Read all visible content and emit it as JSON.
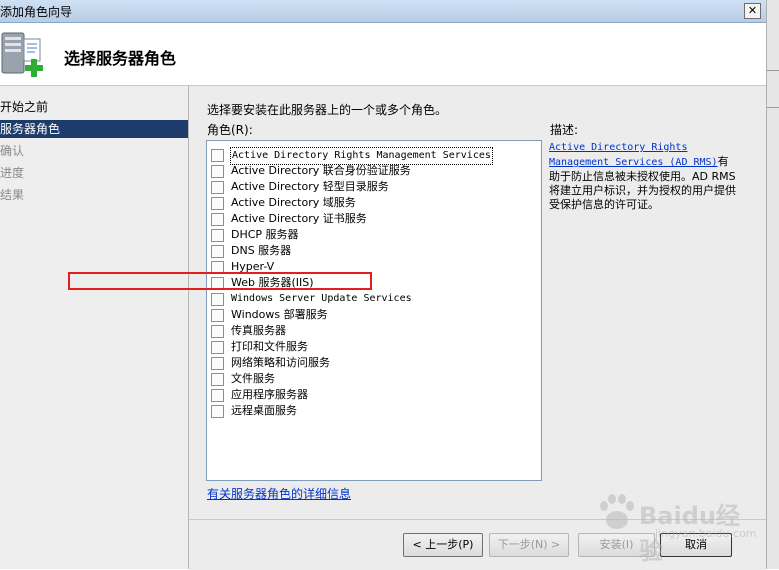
{
  "window": {
    "title": "添加角色向导",
    "close_glyph": "✕"
  },
  "header": {
    "title": "选择服务器角色",
    "icon": "server-add-icon"
  },
  "nav": {
    "items": [
      {
        "label": "开始之前",
        "state": "normal"
      },
      {
        "label": "服务器角色",
        "state": "active"
      },
      {
        "label": "确认",
        "state": "dim"
      },
      {
        "label": "进度",
        "state": "dim"
      },
      {
        "label": "结果",
        "state": "dim"
      }
    ]
  },
  "main": {
    "instruction": "选择要安装在此服务器上的一个或多个角色。",
    "roles_label": "角色(R):",
    "description_label": "描述:",
    "roles": [
      {
        "label": "Active Directory Rights Management Services",
        "checked": false
      },
      {
        "label": "Active Directory 联合身份验证服务",
        "checked": false
      },
      {
        "label": "Active Directory 轻型目录服务",
        "checked": false
      },
      {
        "label": "Active Directory 域服务",
        "checked": false
      },
      {
        "label": "Active Directory 证书服务",
        "checked": false
      },
      {
        "label": "DHCP 服务器",
        "checked": false
      },
      {
        "label": "DNS 服务器",
        "checked": false
      },
      {
        "label": "Hyper-V",
        "checked": false
      },
      {
        "label": "Web 服务器(IIS)",
        "checked": false
      },
      {
        "label": "Windows Server Update Services",
        "checked": false
      },
      {
        "label": "Windows 部署服务",
        "checked": false
      },
      {
        "label": "传真服务器",
        "checked": false
      },
      {
        "label": "打印和文件服务",
        "checked": false
      },
      {
        "label": "网络策略和访问服务",
        "checked": false
      },
      {
        "label": "文件服务",
        "checked": false
      },
      {
        "label": "应用程序服务器",
        "checked": false
      },
      {
        "label": "远程桌面服务",
        "checked": false
      }
    ],
    "description": {
      "link_text": "Active Directory Rights Management Services (AD RMS)",
      "text": "有助于防止信息被未授权使用。AD RMS 将建立用户标识，并为授权的用户提供受保护信息的许可证。"
    },
    "more_info_link": "有关服务器角色的详细信息"
  },
  "footer": {
    "back": "< 上一步(P)",
    "next": "下一步(N) >",
    "install": "安装(I)",
    "cancel": "取消"
  },
  "watermark": {
    "text": "Baidu经验",
    "sub": "jingyan.baidu.com"
  },
  "colors": {
    "accent": "#1d3b6b",
    "highlight_box": "#e0201b",
    "link": "#0033cc"
  }
}
